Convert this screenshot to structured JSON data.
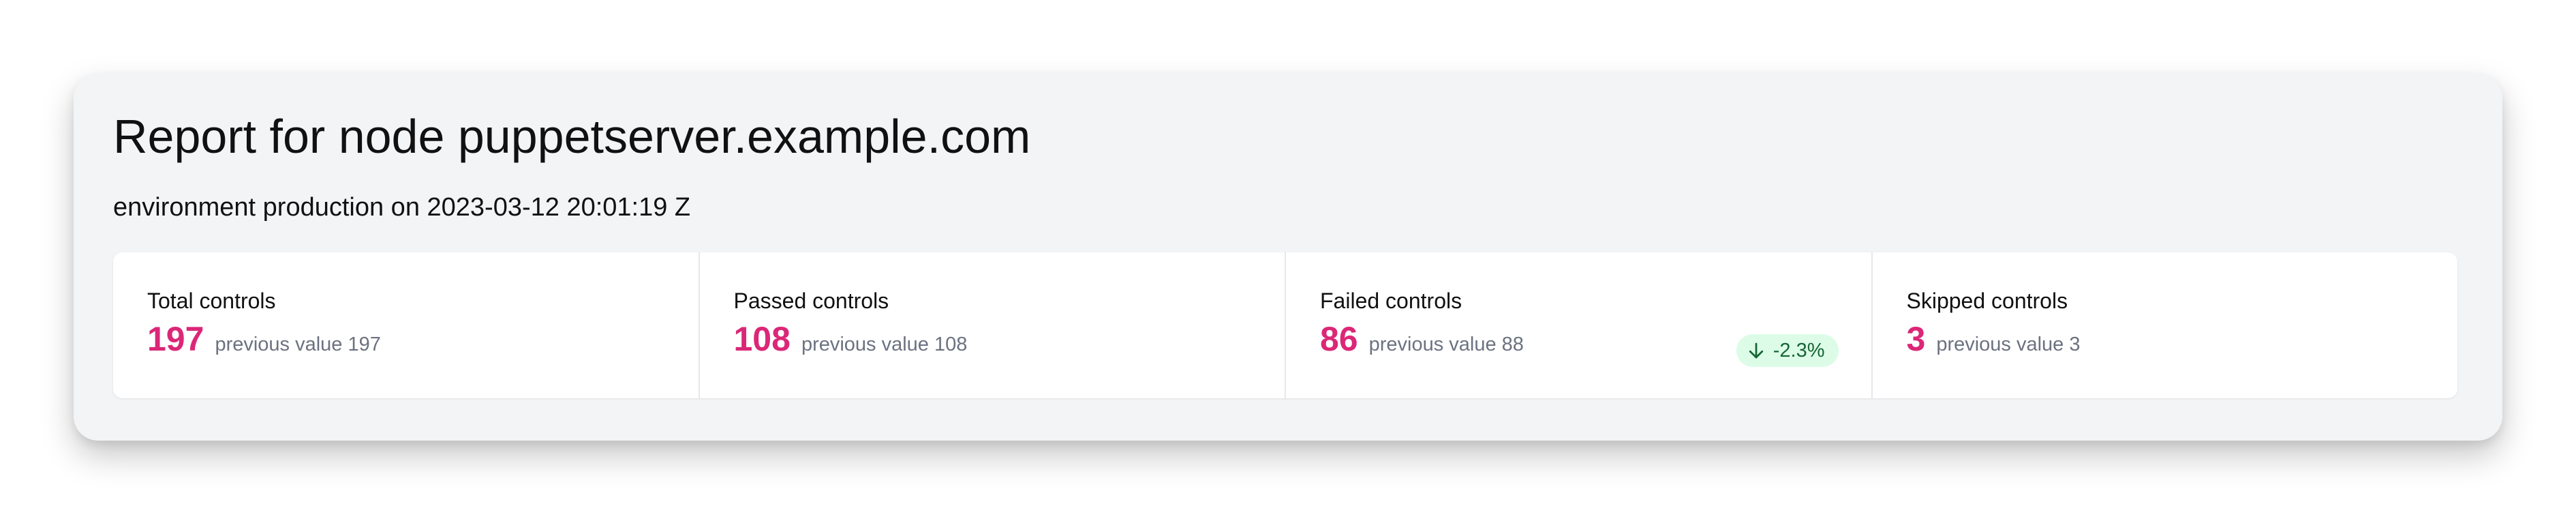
{
  "report": {
    "title": "Report for node puppetserver.example.com",
    "subtitle": "environment production on 2023-03-12 20:01:19 Z"
  },
  "stats": [
    {
      "label": "Total controls",
      "value": "197",
      "previous": "previous value 197"
    },
    {
      "label": "Passed controls",
      "value": "108",
      "previous": "previous value 108"
    },
    {
      "label": "Failed controls",
      "value": "86",
      "previous": "previous value 88",
      "change": {
        "text": "-2.3%",
        "icon": "arrow-down-icon"
      }
    },
    {
      "label": "Skipped controls",
      "value": "3",
      "previous": "previous value 3"
    }
  ],
  "colors": {
    "value": "#db2777",
    "badge_bg": "#dcfce7",
    "badge_text": "#166534",
    "card_bg": "#f3f4f6"
  }
}
